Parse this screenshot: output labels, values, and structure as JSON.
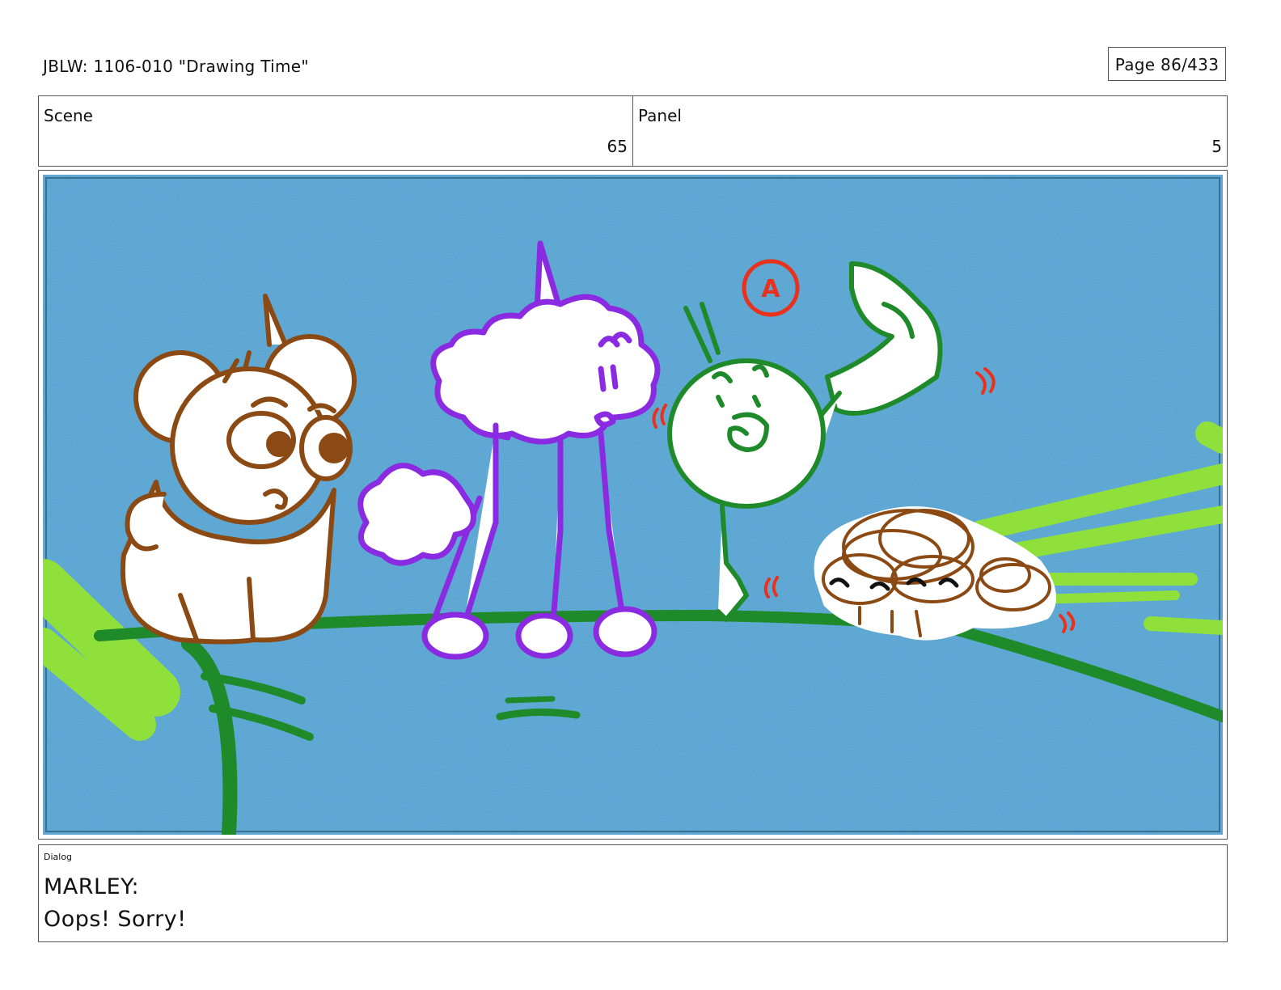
{
  "header": {
    "title": "JBLW: 1106-010 \"Drawing Time\"",
    "page": "Page  86/433"
  },
  "info": {
    "scene_label": "Scene",
    "scene_value": "65",
    "panel_label": "Panel",
    "panel_value": "5"
  },
  "frame": {
    "annotation_letter": "A",
    "colors": {
      "sky": "#4f9fcf",
      "brown": "#8b4a14",
      "purple": "#8a2be2",
      "green": "#1f8a2a",
      "lime": "#8fe03a",
      "red": "#e8321e"
    }
  },
  "dialog": {
    "label": "Dialog",
    "speaker": "MARLEY:",
    "line": "Oops! Sorry!"
  }
}
